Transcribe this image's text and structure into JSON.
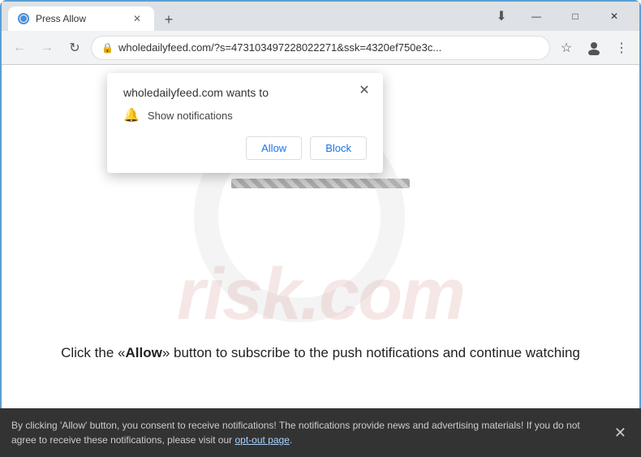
{
  "window": {
    "title": "Press Allow",
    "controls": {
      "minimize": "—",
      "maximize": "□",
      "close": "✕"
    }
  },
  "tab": {
    "title": "Press Allow",
    "close": "✕",
    "new_tab": "+"
  },
  "addressbar": {
    "back": "←",
    "forward": "→",
    "reload": "↻",
    "url": "wholedailyfeed.com/?s=473103497228022271&ssk=4320ef750e3c...",
    "lock": "🔒",
    "star": "☆",
    "account": "👤",
    "menu": "⋮"
  },
  "popup": {
    "site_text": "wholedailyfeed.com wants to",
    "permission": "Show notifications",
    "close": "✕",
    "allow_label": "Allow",
    "block_label": "Block"
  },
  "page": {
    "main_text": "Click the «Allow» button to subscribe to the push notifications and continue watching",
    "watermark": "risk.com"
  },
  "bottombar": {
    "text": "By clicking 'Allow' button, you consent to receive notifications! The notifications provide news and advertising materials! If you do not agree to receive these notifications, please visit our ",
    "link_text": "opt-out page",
    "close": "✕"
  }
}
